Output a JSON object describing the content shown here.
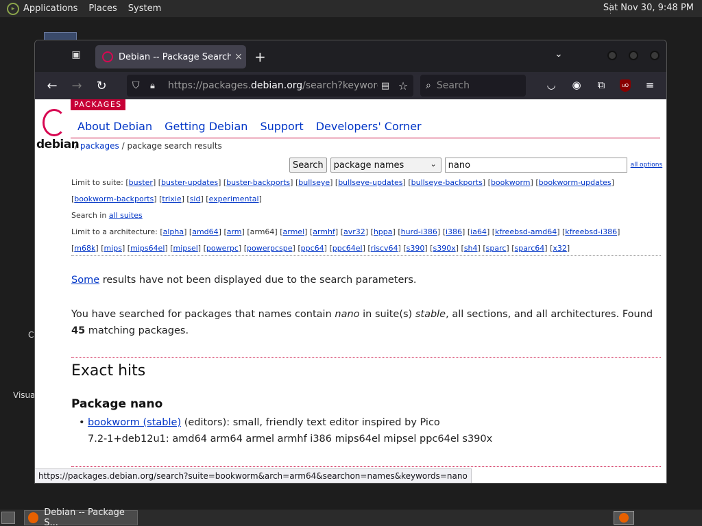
{
  "top_panel": {
    "menus": [
      "Applications",
      "Places",
      "System"
    ],
    "clock": "Sat Nov 30,  9:48 PM"
  },
  "desktop": {
    "labels": [
      "C",
      "Visua"
    ]
  },
  "browser": {
    "tab": {
      "title": "Debian -- Package Search R",
      "close": "×"
    },
    "new_tab": "+",
    "url_prefix": "https://packages.",
    "url_domain": "debian.org",
    "url_suffix": "/search?keywords=",
    "search_placeholder": "Search",
    "ublock_label": "uO"
  },
  "page": {
    "packages_tag": "PACKAGES",
    "logo_text": "debian",
    "nav": [
      "About Debian",
      "Getting Debian",
      "Support",
      "Developers' Corner"
    ],
    "breadcrumb": {
      "sep1": "/ ",
      "packages": "packages",
      "sep2": " / ",
      "current": "package search results"
    },
    "search": {
      "button": "Search",
      "select_value": "package names",
      "keyword": "nano",
      "all_options": "all options"
    },
    "suite_label": "Limit to suite: ",
    "suites": [
      "buster",
      "buster-updates",
      "buster-backports",
      "bullseye",
      "bullseye-updates",
      "bullseye-backports",
      "bookworm",
      "bookworm-updates",
      "bookworm-backports",
      "trixie",
      "sid",
      "experimental"
    ],
    "search_in_label": "Search in ",
    "all_suites": "all suites",
    "arch_label": "Limit to a architecture: ",
    "archs": [
      "alpha",
      "amd64",
      "arm",
      "arm64",
      "armel",
      "armhf",
      "avr32",
      "hppa",
      "hurd-i386",
      "i386",
      "ia64",
      "kfreebsd-amd64",
      "kfreebsd-i386",
      "m68k",
      "mips",
      "mips64el",
      "mipsel",
      "powerpc",
      "powerpcspe",
      "ppc64",
      "ppc64el",
      "riscv64",
      "s390",
      "s390x",
      "sh4",
      "sparc",
      "sparc64",
      "x32"
    ],
    "selected_arch": "arm64",
    "some_link": "Some",
    "some_rest": " results have not been displayed due to the search parameters.",
    "summary": {
      "p1": "You have searched for packages that names contain ",
      "kw": "nano",
      "p2": " in suite(s) ",
      "suite": "stable",
      "p3": ", all sections, and all architectures. Found ",
      "count": "45",
      "p4": " matching packages."
    },
    "exact_hits": "Exact hits",
    "package_heading": "Package nano",
    "result": {
      "link": "bookworm (stable)",
      "desc": " (editors): small, friendly text editor inspired by Pico",
      "versions": "7.2-1+deb12u1: amd64 arm64 armel armhf i386 mips64el mipsel ppc64el s390x"
    },
    "status_url": "https://packages.debian.org/search?suite=bookworm&arch=arm64&searchon=names&keywords=nano"
  },
  "taskbar": {
    "window_title": "Debian -- Package S..."
  }
}
